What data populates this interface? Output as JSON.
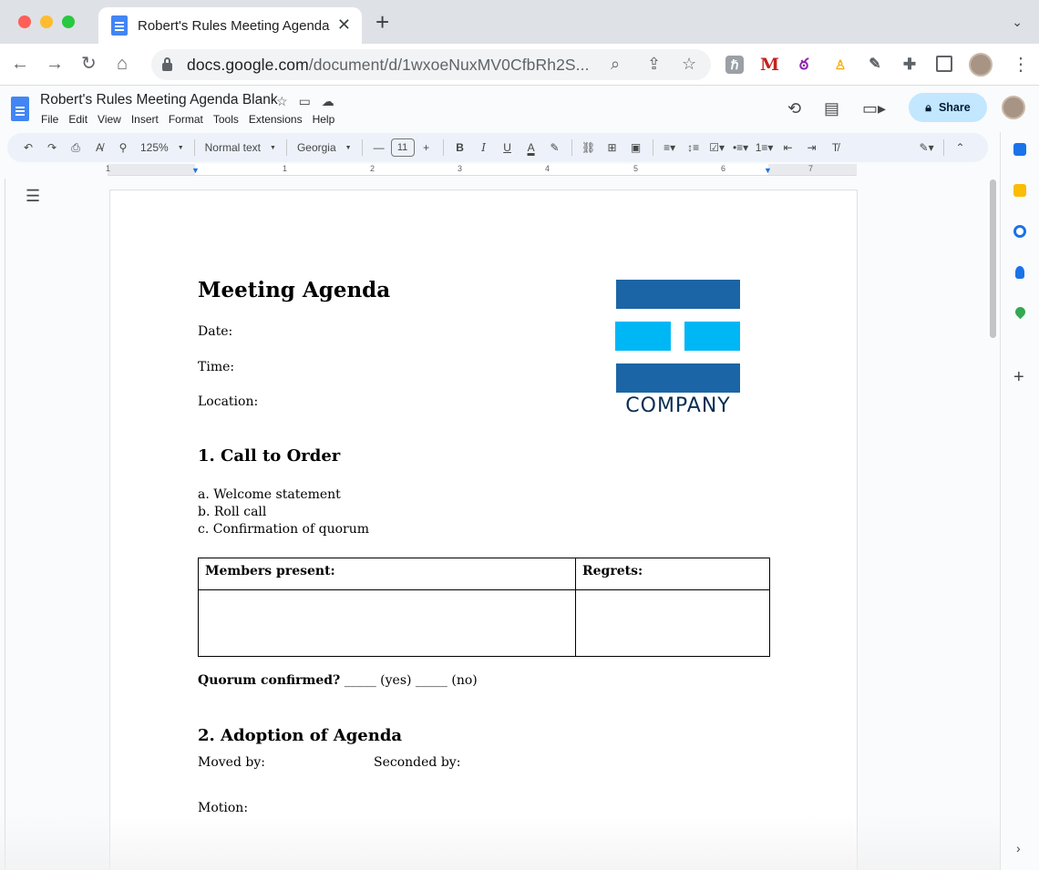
{
  "browser": {
    "tab_title": "Robert's Rules Meeting Agenda Blank",
    "url_host": "docs.google.com",
    "url_path": "/document/d/1wxoeNuxMV0CfbRh2S..."
  },
  "docs_header": {
    "doc_title": "Robert's Rules Meeting Agenda Blank",
    "menu": [
      "File",
      "Edit",
      "View",
      "Insert",
      "Format",
      "Tools",
      "Extensions",
      "Help"
    ],
    "share_label": "Share"
  },
  "toolbar": {
    "zoom": "125%",
    "style": "Normal text",
    "font": "Georgia",
    "font_size": "11"
  },
  "ruler": {
    "numbers": [
      "1",
      "1",
      "2",
      "3",
      "4",
      "5",
      "6",
      "7"
    ]
  },
  "document": {
    "title": "Meeting Agenda",
    "date_label": "Date:",
    "time_label": "Time:",
    "location_label": "Location:",
    "logo_text": "COMPANY",
    "section1_heading": "1. Call to Order",
    "section1_items": [
      "a. Welcome statement",
      "b. Roll call",
      "c. Confirmation of quorum"
    ],
    "table": {
      "col1_header": "Members present:",
      "col2_header": "Regrets:"
    },
    "quorum_label": "Quorum confirmed?",
    "quorum_rest": " _____ (yes) _____ (no)",
    "section2_heading": "2. Adoption of Agenda",
    "moved_by": "Moved by:",
    "seconded_by": "Seconded by:",
    "motion": "Motion:"
  },
  "colors": {
    "logo_dark_blue": "#1b65a6",
    "logo_light_blue": "#00b7f6",
    "share_button": "#c2e7ff",
    "toolbar_bg": "#edf2fa"
  }
}
